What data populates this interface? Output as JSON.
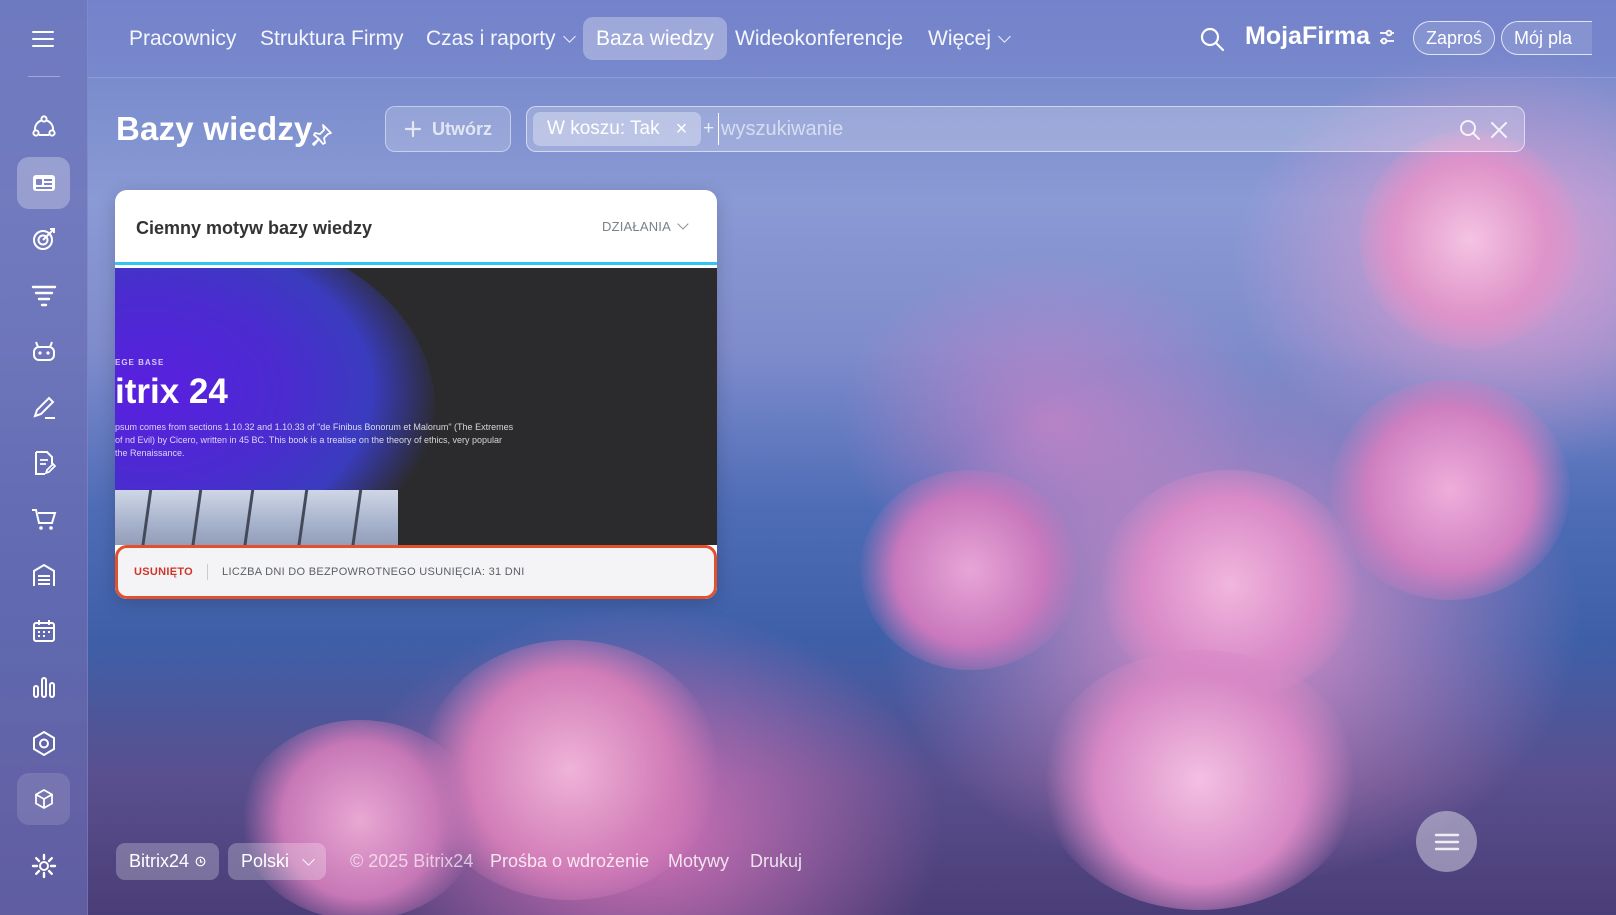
{
  "sidebar": {
    "items": [
      {
        "icon": "hub-icon"
      },
      {
        "icon": "knowledge-base-icon",
        "active": true
      },
      {
        "icon": "target-icon"
      },
      {
        "icon": "funnel-icon"
      },
      {
        "icon": "robot-icon"
      },
      {
        "icon": "pencil-icon"
      },
      {
        "icon": "document-edit-icon"
      },
      {
        "icon": "cart-icon"
      },
      {
        "icon": "store-icon"
      },
      {
        "icon": "calendar-icon"
      },
      {
        "icon": "analytics-icon"
      },
      {
        "icon": "hexagon-icon"
      },
      {
        "icon": "box-icon"
      },
      {
        "icon": "settings-icon"
      }
    ]
  },
  "topnav": {
    "items": [
      {
        "label": "Pracownicy"
      },
      {
        "label": "Struktura Firmy"
      },
      {
        "label": "Czas i raporty"
      },
      {
        "label": "Baza wiedzy"
      },
      {
        "label": "Wideokonferencje"
      },
      {
        "label": "Więcej"
      }
    ],
    "brand": "MojaFirma",
    "invite": "Zaproś",
    "my_plan": "Mój pla"
  },
  "header": {
    "title": "Bazy wiedzy",
    "create_label": "Utwórz"
  },
  "filter": {
    "tag": "W koszu: Tak",
    "plus": "+",
    "placeholder": "wyszukiwanie"
  },
  "card": {
    "title": "Ciemny motyw bazy wiedzy",
    "actions": "DZIAŁANIA",
    "preview": {
      "overline": "EGE BASE",
      "heading": "itrix 24",
      "text": "psum comes from sections 1.10.32 and 1.10.33 of \"de Finibus Bonorum et Malorum\" (The Extremes of nd Evil) by Cicero, written in 45 BC. This book is a treatise on the theory of ethics, very popular the Renaissance."
    },
    "status": "USUNIĘTO",
    "days_left": "LICZBA DNI DO BEZPOWROTNEGO USUNIĘCIA: 31 DNI"
  },
  "footer": {
    "bitrix": "Bitrix24",
    "language": "Polski",
    "copyright": "© 2025 Bitrix24",
    "links": [
      "Prośba o wdrożenie",
      "Motywy",
      "Drukuj"
    ]
  },
  "colors": {
    "accent_line": "#2fc6f6",
    "deleted_border": "#e2502c",
    "deleted_text": "#d0352a"
  }
}
